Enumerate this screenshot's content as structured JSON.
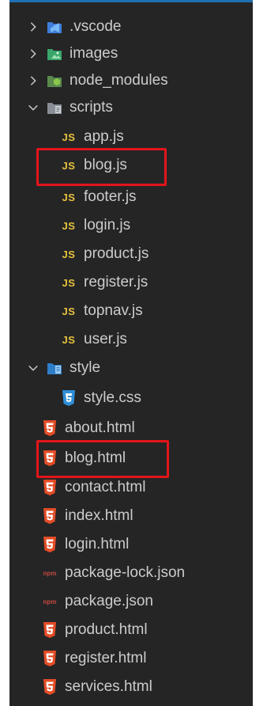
{
  "explorer": {
    "items": [
      {
        "label": ".vscode",
        "type": "folder",
        "state": "collapsed",
        "icon": "vscode-folder-icon"
      },
      {
        "label": "images",
        "type": "folder",
        "state": "collapsed",
        "icon": "images-folder-icon"
      },
      {
        "label": "node_modules",
        "type": "folder",
        "state": "collapsed",
        "icon": "node-folder-icon"
      },
      {
        "label": "scripts",
        "type": "folder",
        "state": "expanded",
        "icon": "scripts-folder-icon"
      },
      {
        "label": "app.js",
        "type": "js"
      },
      {
        "label": "blog.js",
        "type": "js",
        "highlighted": true
      },
      {
        "label": "footer.js",
        "type": "js"
      },
      {
        "label": "login.js",
        "type": "js"
      },
      {
        "label": "product.js",
        "type": "js"
      },
      {
        "label": "register.js",
        "type": "js"
      },
      {
        "label": "topnav.js",
        "type": "js"
      },
      {
        "label": "user.js",
        "type": "js"
      },
      {
        "label": "style",
        "type": "folder",
        "state": "expanded",
        "icon": "style-folder-icon"
      },
      {
        "label": "style.css",
        "type": "css"
      },
      {
        "label": "about.html",
        "type": "html"
      },
      {
        "label": "blog.html",
        "type": "html",
        "highlighted": true
      },
      {
        "label": "contact.html",
        "type": "html"
      },
      {
        "label": "index.html",
        "type": "html"
      },
      {
        "label": "login.html",
        "type": "html"
      },
      {
        "label": "package-lock.json",
        "type": "npm"
      },
      {
        "label": "package.json",
        "type": "npm"
      },
      {
        "label": "product.html",
        "type": "html"
      },
      {
        "label": "register.html",
        "type": "html"
      },
      {
        "label": "services.html",
        "type": "html"
      }
    ],
    "js_badge": "JS",
    "npm_badge": "npm"
  },
  "colors": {
    "background": "#252526",
    "text": "#cccccc",
    "js": "#e8c33c",
    "html": "#e44d26",
    "css": "#2f8fd8",
    "highlight": "#e3151a"
  }
}
